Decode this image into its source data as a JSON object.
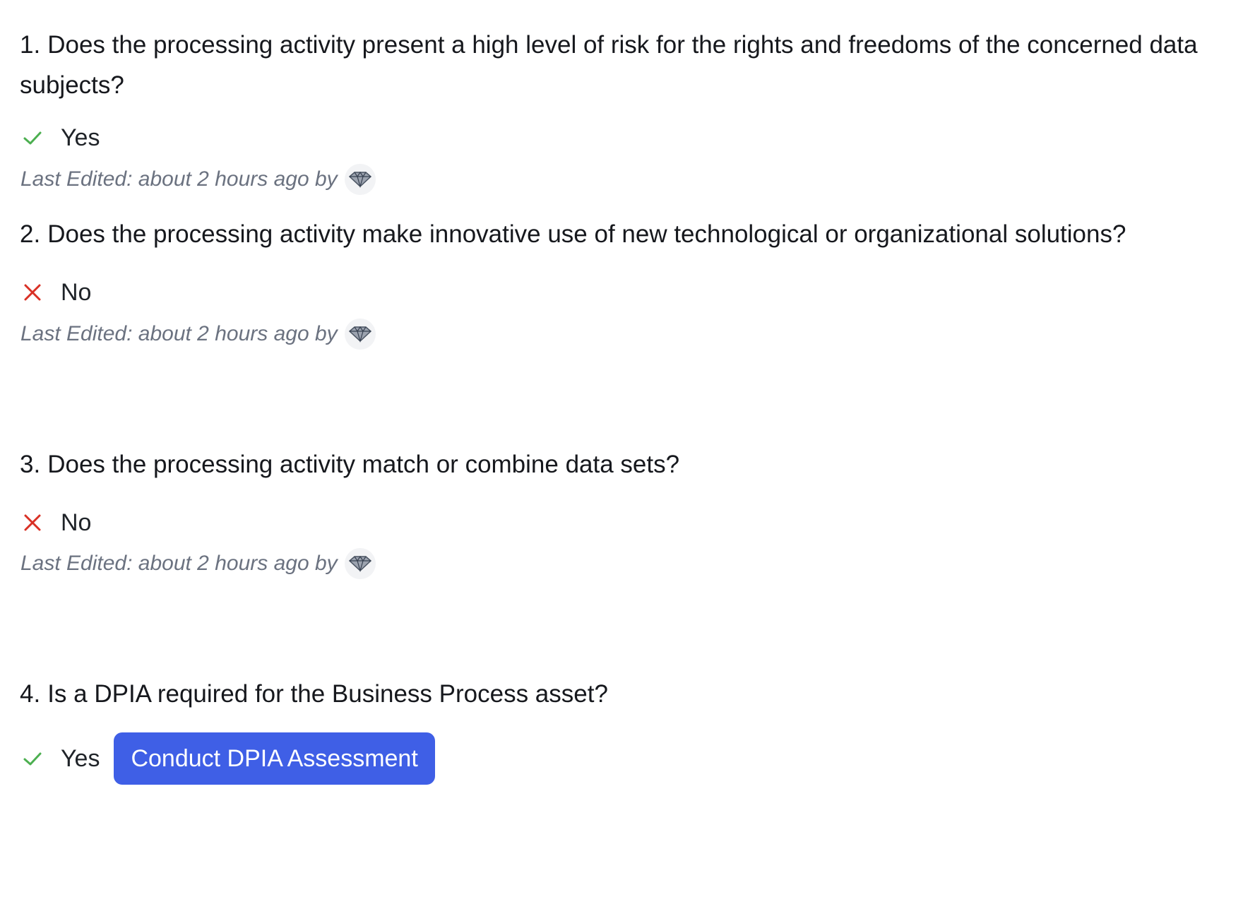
{
  "questions": [
    {
      "number": "1.",
      "text": "Does the processing activity present a high level of risk for the rights and freedoms of the concerned data subjects?",
      "answer": "Yes",
      "answer_icon": "check-icon",
      "last_edited": "Last Edited: about 2 hours ago by"
    },
    {
      "number": "2.",
      "text": "Does the processing activity make innovative use of new technological or organizational solutions?",
      "answer": "No",
      "answer_icon": "x-icon",
      "last_edited": "Last Edited: about 2 hours ago by"
    },
    {
      "number": "3.",
      "text": "Does the processing activity match or combine data sets?",
      "answer": "No",
      "answer_icon": "x-icon",
      "last_edited": "Last Edited: about 2 hours ago by"
    },
    {
      "number": "4.",
      "text": "Is a DPIA required for the Business Process asset?",
      "answer": "Yes",
      "answer_icon": "check-icon",
      "action_button": "Conduct DPIA Assessment"
    }
  ],
  "colors": {
    "check": "#4caf50",
    "cross": "#d93025",
    "button": "#3f5fe6",
    "muted_text": "#6b7280"
  },
  "avatar_icon": "diamond-avatar-icon"
}
